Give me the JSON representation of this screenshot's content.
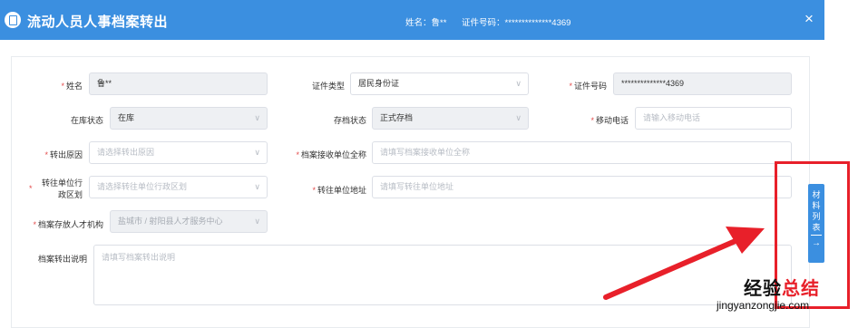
{
  "dialog": {
    "title": "流动人员人事档案转出",
    "name_label": "姓名：鲁**",
    "id_label": "证件号码：**************4369",
    "close_glyph": "×",
    "title_icon": "document-icon"
  },
  "form": {
    "name": {
      "label": "姓名",
      "value": "鲁**"
    },
    "id_type": {
      "label": "证件类型",
      "value": "居民身份证"
    },
    "id_number": {
      "label": "证件号码",
      "value": "**************4369"
    },
    "stock_status": {
      "label": "在库状态",
      "value": "在库"
    },
    "archive_status": {
      "label": "存档状态",
      "value": "正式存档"
    },
    "mobile": {
      "label": "移动电话",
      "placeholder": "请输入移动电话"
    },
    "transfer_reason": {
      "label": "转出原因",
      "placeholder": "请选择转出原因"
    },
    "receiver_name": {
      "label": "档案接收单位全称",
      "placeholder": "请填写档案接收单位全称"
    },
    "target_region": {
      "label_line1": "转往单位行",
      "label_line2": "政区划",
      "placeholder": "请选择转往单位行政区划"
    },
    "target_address": {
      "label": "转往单位地址",
      "placeholder": "请填写转往单位地址"
    },
    "talent_org": {
      "label": "档案存放人才机构",
      "value": "盐城市 / 射阳县人才服务中心"
    },
    "note": {
      "label": "档案转出说明",
      "placeholder": "请填写档案转出说明"
    }
  },
  "side_tab": {
    "text": "材料列表",
    "arrow": "→"
  },
  "watermark": {
    "text_a": "经验",
    "text_b": "总结",
    "url": "jingyanzongjie.com"
  },
  "colors": {
    "primary": "#3b8fe0",
    "required": "#e34b4b",
    "annotation": "#e8202a"
  }
}
